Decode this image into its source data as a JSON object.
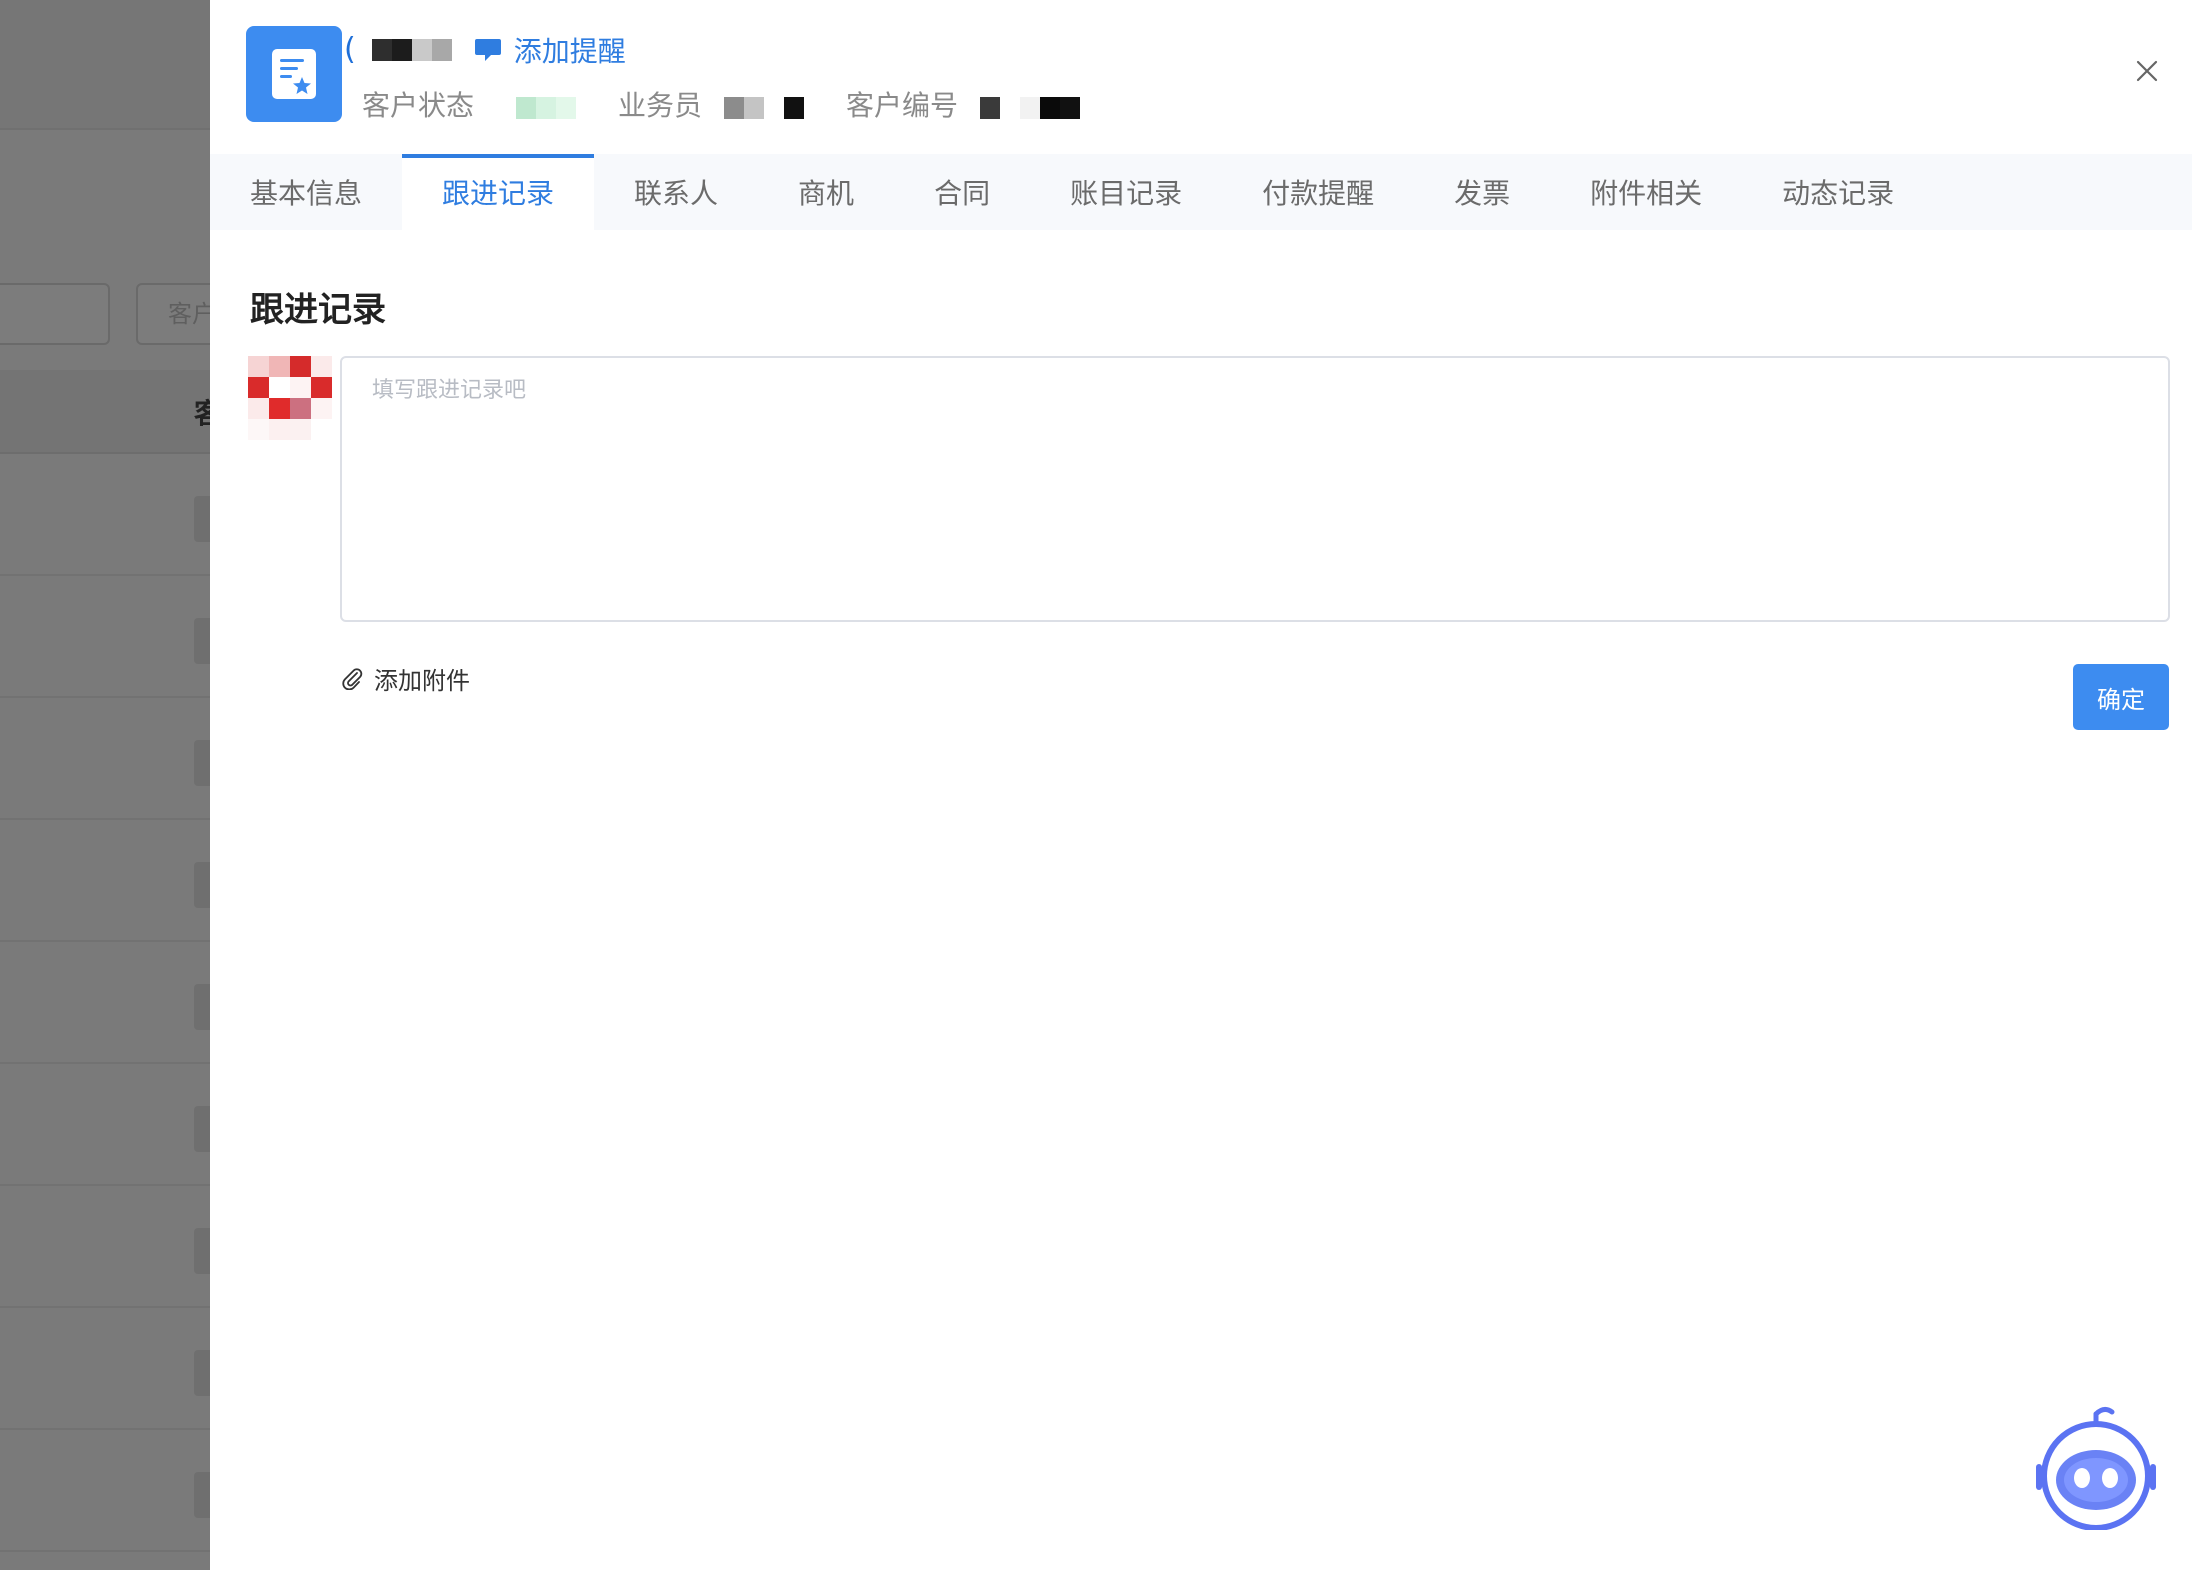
{
  "background": {
    "search_placeholder": "客户",
    "column_header": "客"
  },
  "header": {
    "paren": "(",
    "reminder_label": "添加提醒",
    "meta": [
      {
        "label": "客户状态"
      },
      {
        "label": "业务员"
      },
      {
        "label": "客户编号"
      }
    ],
    "accent_color": "#3d8cf0"
  },
  "tabs": [
    {
      "label": "基本信息",
      "active": false
    },
    {
      "label": "跟进记录",
      "active": true
    },
    {
      "label": "联系人",
      "active": false
    },
    {
      "label": "商机",
      "active": false
    },
    {
      "label": "合同",
      "active": false
    },
    {
      "label": "账目记录",
      "active": false
    },
    {
      "label": "付款提醒",
      "active": false
    },
    {
      "label": "发票",
      "active": false
    },
    {
      "label": "附件相关",
      "active": false
    },
    {
      "label": "动态记录",
      "active": false
    }
  ],
  "followup": {
    "title": "跟进记录",
    "placeholder": "填写跟进记录吧",
    "attach_label": "添加附件",
    "confirm_label": "确定"
  },
  "icons": {
    "app": "document-star-icon",
    "reminder": "chat-bubble-icon",
    "close": "close-icon",
    "attach": "paperclip-icon",
    "assistant": "robot-assistant-icon"
  }
}
